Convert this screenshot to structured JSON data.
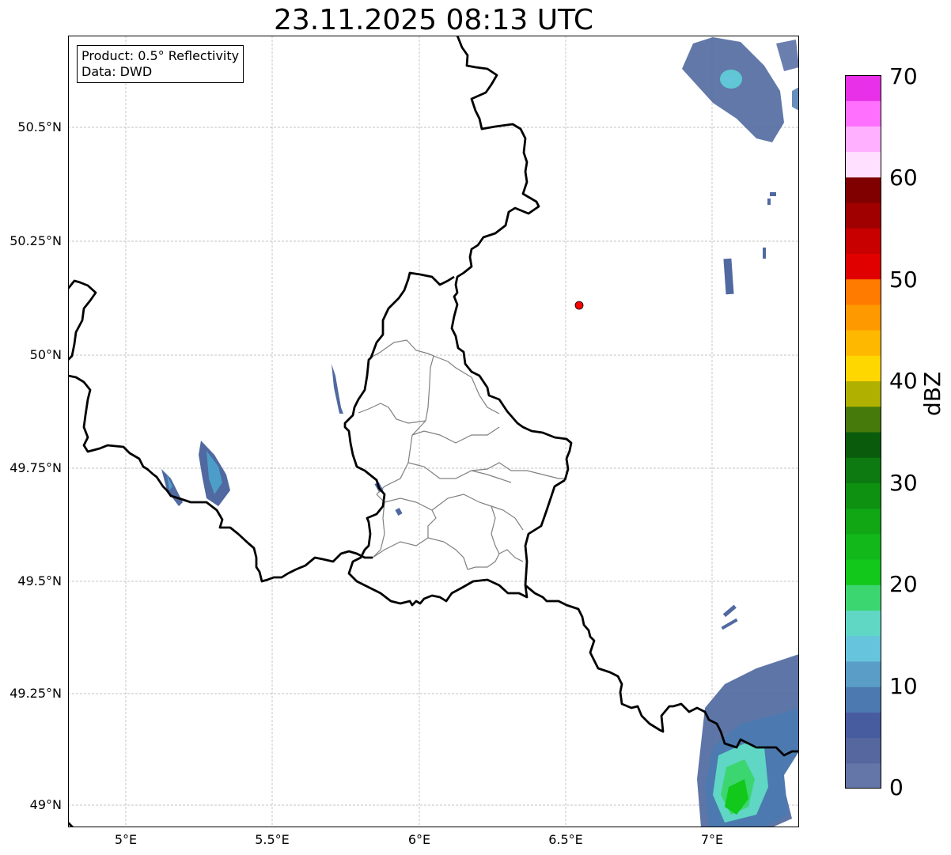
{
  "title": "23.11.2025 08:13 UTC",
  "infobox": {
    "product": "Product: 0.5° Reflectivity",
    "data": "Data: DWD"
  },
  "map": {
    "lat_labels": [
      "50.5°N",
      "50.25°N",
      "50°N",
      "49.75°N",
      "49.5°N",
      "49.25°N",
      "49°N"
    ],
    "lon_labels": [
      "5°E",
      "5.5°E",
      "6°E",
      "6.5°E",
      "7°E"
    ],
    "marker_color": "#ff0000",
    "border_color": "#000000",
    "district_color": "#808080",
    "grid": true
  },
  "colorbar": {
    "unit": "dBZ",
    "ticks": [
      "0",
      "10",
      "20",
      "30",
      "40",
      "50",
      "60",
      "70"
    ],
    "colors": [
      "#6475a8",
      "#56679f",
      "#475c9f",
      "#4c7ab0",
      "#5a9ec8",
      "#66c4dc",
      "#5fd7c4",
      "#3cd670",
      "#12c81a",
      "#12b81a",
      "#10a614",
      "#0e9010",
      "#0c7a10",
      "#0a5c0c",
      "#467a0a",
      "#b0b000",
      "#ffd700",
      "#ffb800",
      "#ff9900",
      "#ff7b00",
      "#e00000",
      "#c80000",
      "#a00000",
      "#800000",
      "#ffe0ff",
      "#ffb0ff",
      "#ff70ff",
      "#e830e8"
    ]
  }
}
